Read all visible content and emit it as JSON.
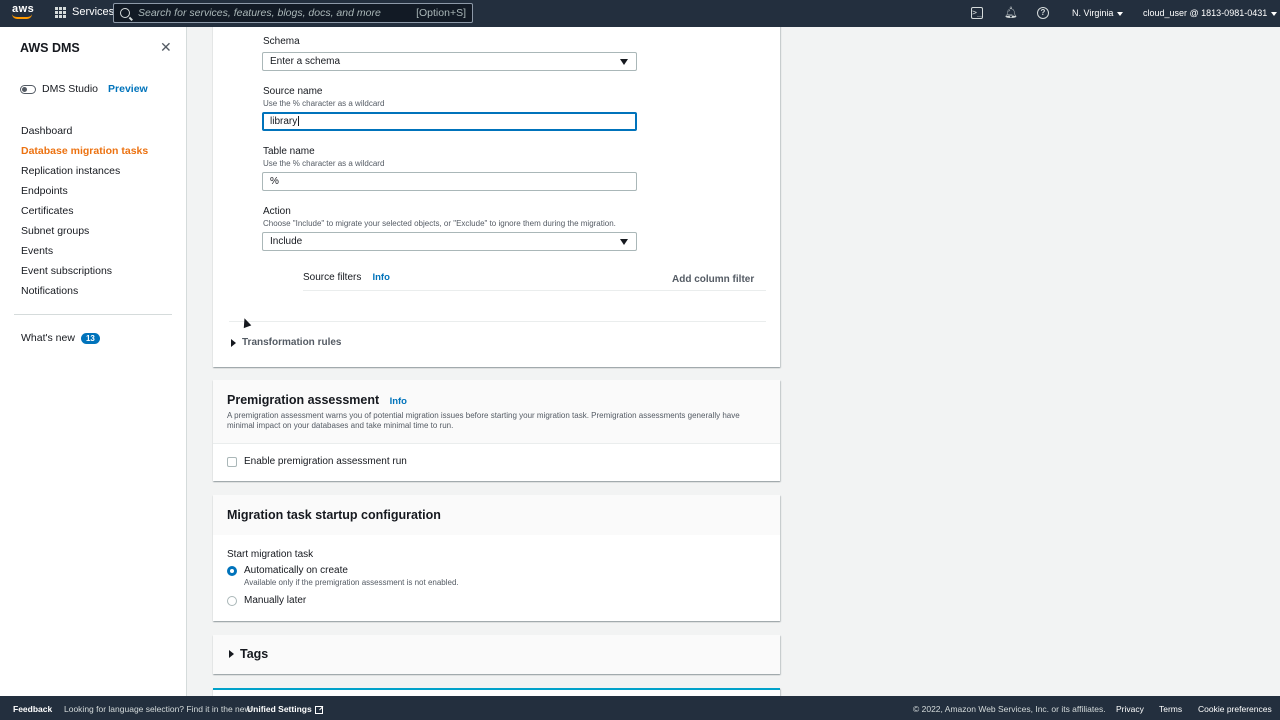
{
  "topnav": {
    "logo": "aws",
    "services_label": "Services",
    "search_placeholder": "Search for services, features, blogs, docs, and more",
    "search_shortcut": "[Option+S]",
    "region": "N. Virginia",
    "user": "cloud_user @ 1813-0981-0431"
  },
  "sidebar": {
    "title": "AWS DMS",
    "studio_label": "DMS Studio",
    "preview_label": "Preview",
    "items": [
      {
        "label": "Dashboard"
      },
      {
        "label": "Database migration tasks"
      },
      {
        "label": "Replication instances"
      },
      {
        "label": "Endpoints"
      },
      {
        "label": "Certificates"
      },
      {
        "label": "Subnet groups"
      },
      {
        "label": "Events"
      },
      {
        "label": "Event subscriptions"
      },
      {
        "label": "Notifications"
      }
    ],
    "active_item": "Database migration tasks",
    "whats_new_label": "What's new",
    "whats_new_count": "13"
  },
  "selection_rule": {
    "schema_label": "Schema",
    "schema_value": "Enter a schema",
    "source_name_label": "Source name",
    "source_name_desc": "Use the % character as a wildcard",
    "source_name_value": "library",
    "table_name_label": "Table name",
    "table_name_desc": "Use the % character as a wildcard",
    "table_name_value": "%",
    "action_label": "Action",
    "action_desc": "Choose \"Include\" to migrate your selected objects, or \"Exclude\" to ignore them during the migration.",
    "action_value": "Include",
    "source_filters_label": "Source filters",
    "info_label": "Info",
    "add_column_filter_label": "Add column filter",
    "transformation_rules_label": "Transformation rules"
  },
  "premigration": {
    "title": "Premigration assessment",
    "info_label": "Info",
    "description": "A premigration assessment warns you of potential migration issues before starting your migration task. Premigration assessments generally have minimal impact on your databases and take minimal time to run.",
    "checkbox_label": "Enable premigration assessment run",
    "checked": false
  },
  "startup": {
    "title": "Migration task startup configuration",
    "start_label": "Start migration task",
    "options": [
      {
        "label": "Automatically on create",
        "desc": "Available only if the premigration assessment is not enabled.",
        "selected": true
      },
      {
        "label": "Manually later",
        "desc": "",
        "selected": false
      }
    ]
  },
  "tags": {
    "label": "Tags"
  },
  "footer": {
    "feedback": "Feedback",
    "language_text": "Looking for language selection? Find it in the new",
    "unified_settings": "Unified Settings",
    "copyright": "© 2022, Amazon Web Services, Inc. or its affiliates.",
    "privacy": "Privacy",
    "terms": "Terms",
    "cookie": "Cookie preferences"
  },
  "colors": {
    "nav_bg": "#232f3e",
    "active_orange": "#ec7211",
    "link_blue": "#0073bb"
  }
}
